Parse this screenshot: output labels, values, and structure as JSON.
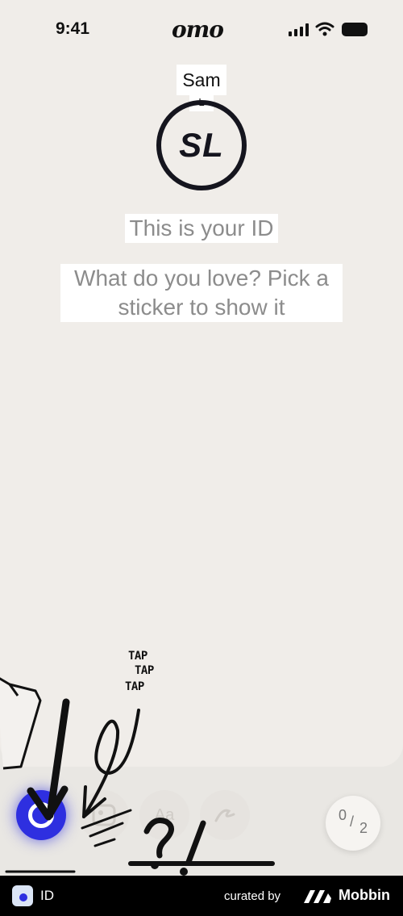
{
  "status_bar": {
    "time": "9:41",
    "app_logo": "omo"
  },
  "profile": {
    "name": "Sam",
    "last_initial": "L",
    "avatar_initials": "SL",
    "heading": "This is your ID",
    "prompt": "What do you love? Pick a sticker to show it"
  },
  "hint": {
    "tap_1": "TAP",
    "tap_2": "TAP",
    "tap_3": "TAP",
    "marks": "?!"
  },
  "toolbar": {
    "tools": [
      "sticker-icon",
      "photo-icon",
      "text-icon",
      "draw-icon"
    ],
    "text_tool_label": "Aa",
    "counter_current": "0",
    "counter_separator": "/",
    "counter_total": "2"
  },
  "footer": {
    "app_name": "ID",
    "curated_by": "curated by",
    "brand": "Mobbin"
  },
  "colors": {
    "accent": "#2e2fe0",
    "card": "#f0ede9",
    "text_muted": "#8c8c8c",
    "footer": "#000000"
  }
}
